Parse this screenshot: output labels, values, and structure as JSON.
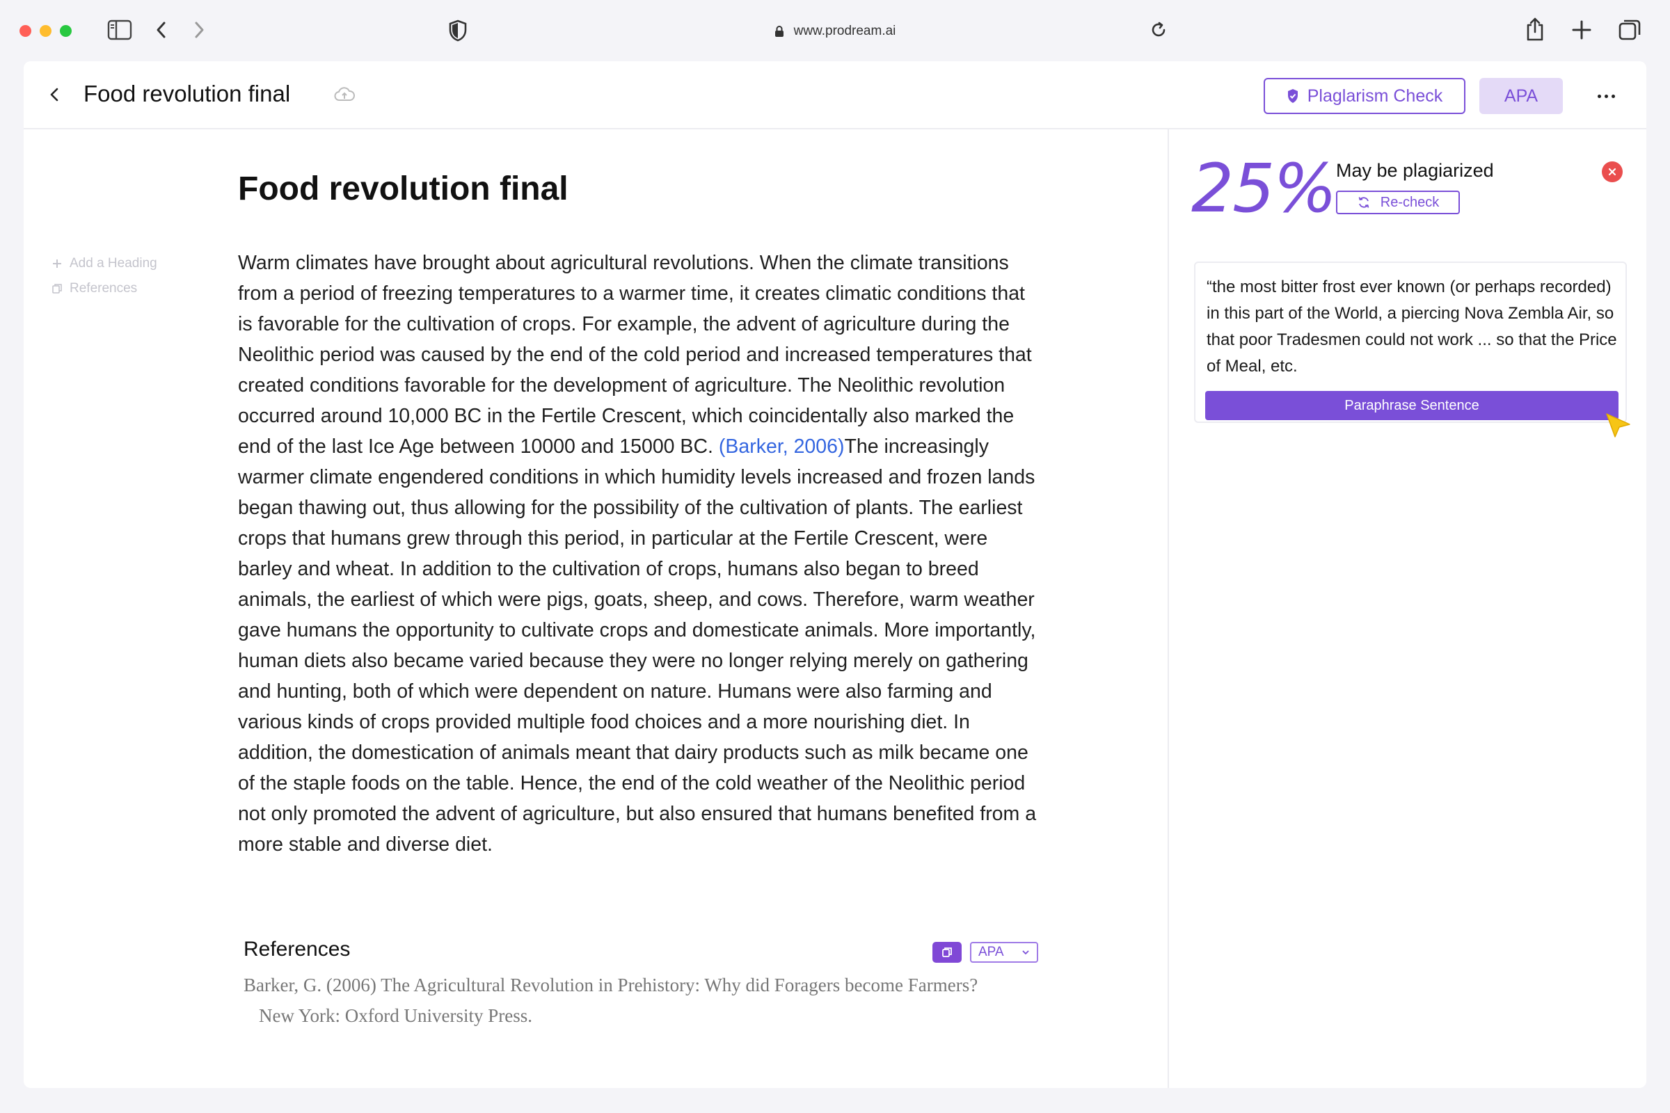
{
  "browser": {
    "url": "www.prodream.ai"
  },
  "topbar": {
    "title": "Food revolution final",
    "plagiarism_label": "Plaglarism Check",
    "style_label": "APA"
  },
  "outline": {
    "add_heading": "Add a Heading",
    "references": "References"
  },
  "document": {
    "heading": "Food revolution final",
    "body_before_citation": "Warm climates have brought about agricultural revolutions. When the climate transitions from a period of freezing temperatures to a warmer time, it creates climatic conditions that is favorable for the cultivation of crops. For example, the advent of agriculture during the Neolithic period was caused by the end of the cold period and increased temperatures that created conditions favorable for the development of agriculture. The Neolithic revolution occurred around 10,000 BC in the Fertile Crescent, which coincidentally also marked the end of the last Ice Age between 10000 and 15000 BC. ",
    "citation": "(Barker, 2006)",
    "body_after_citation": "The increasingly warmer climate engendered conditions in which humidity levels increased and frozen lands began thawing out, thus allowing for the possibility of the cultivation of plants. The earliest crops that humans grew through this period, in particular at the Fertile Crescent, were barley and wheat. In addition to the cultivation of crops, humans also began to breed animals, the earliest of which were pigs, goats, sheep, and cows. Therefore, warm weather gave humans the opportunity to cultivate crops and domesticate animals. More importantly, human diets also became varied because they were no longer relying merely on gathering and hunting, both of which were dependent on nature. Humans were also farming and various kinds of crops provided multiple food choices and a more nourishing diet. In addition, the domestication of animals meant that dairy products such as milk became one of the staple foods on the table. Hence, the end of the cold weather of the Neolithic period not only promoted the advent of agriculture, but also ensured that humans benefited from a more stable and diverse diet."
  },
  "references": {
    "title": "References",
    "style_select": "APA",
    "entry_line1": "Barker, G. (2006) The Agricultural Revolution in Prehistory: Why did Foragers become Farmers?",
    "entry_line2": "New York: Oxford University Press."
  },
  "plagiarism_panel": {
    "score": "25%",
    "status": "May be plagiarized",
    "recheck_label": "Re-check",
    "quote": "“the most bitter frost ever known (or perhaps recorded) in this part of the World, a piercing Nova Zembla Air, so that poor Tradesmen could not work ... so that the Price of Meal, etc.",
    "paraphrase_label": "Paraphrase Sentence"
  },
  "colors": {
    "accent": "#7a4fd8",
    "accent_light": "#e4daf7",
    "citation": "#3466e0",
    "close": "#ea4e4e"
  }
}
